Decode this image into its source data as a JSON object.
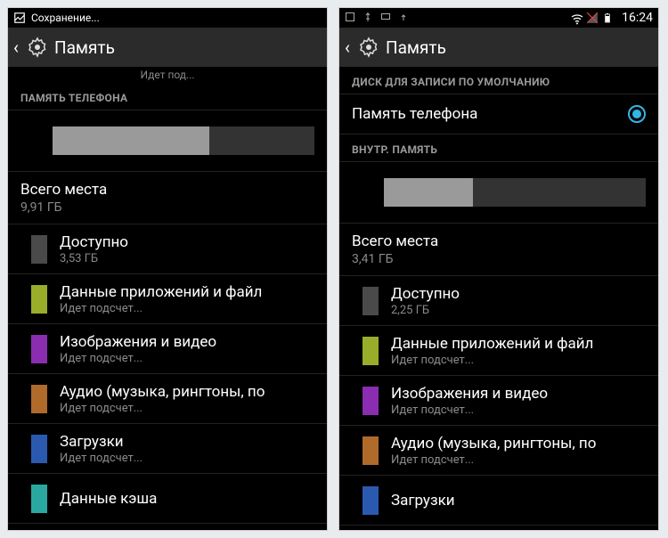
{
  "left": {
    "status": {
      "saving": "Сохранение..."
    },
    "title": "Память",
    "section_phone": "ПАМЯТЬ ТЕЛЕФОНА",
    "bar_used_pct": 60,
    "total_label": "Всего места",
    "total_value": "9,91 ГБ",
    "items": [
      {
        "label": "Доступно",
        "sub": "3,53 ГБ",
        "color": "#4a4a4a"
      },
      {
        "label": "Данные приложений и файл",
        "sub": "Идет подсчет...",
        "color": "#9aad2a"
      },
      {
        "label": "Изображения и видео",
        "sub": "Идет подсчет...",
        "color": "#8a2db0"
      },
      {
        "label": "Аудио (музыка, рингтоны, по",
        "sub": "Идет подсчет...",
        "color": "#b06a2a"
      },
      {
        "label": "Загрузки",
        "sub": "Идет подсчет...",
        "color": "#2a5ab0"
      },
      {
        "label": "Данные кэша",
        "sub": "",
        "color": "#2aa8a0"
      }
    ],
    "fade_text": "Идет под..."
  },
  "right": {
    "status": {
      "time": "16:24"
    },
    "title": "Память",
    "section_default": "ДИСК ДЛЯ ЗАПИСИ ПО УМОЛЧАНИЮ",
    "radio_label": "Память телефона",
    "section_internal": "ВНУТР. ПАМЯТЬ",
    "bar_used_pct": 34,
    "total_label": "Всего места",
    "total_value": "3,41 ГБ",
    "items": [
      {
        "label": "Доступно",
        "sub": "2,25 ГБ",
        "color": "#4a4a4a"
      },
      {
        "label": "Данные приложений и файл",
        "sub": "Идет подсчет...",
        "color": "#9aad2a"
      },
      {
        "label": "Изображения и видео",
        "sub": "Идет подсчет...",
        "color": "#8a2db0"
      },
      {
        "label": "Аудио (музыка, рингтоны, по",
        "sub": "Идет подсчет...",
        "color": "#b06a2a"
      },
      {
        "label": "Загрузки",
        "sub": "",
        "color": "#2a5ab0"
      }
    ]
  }
}
